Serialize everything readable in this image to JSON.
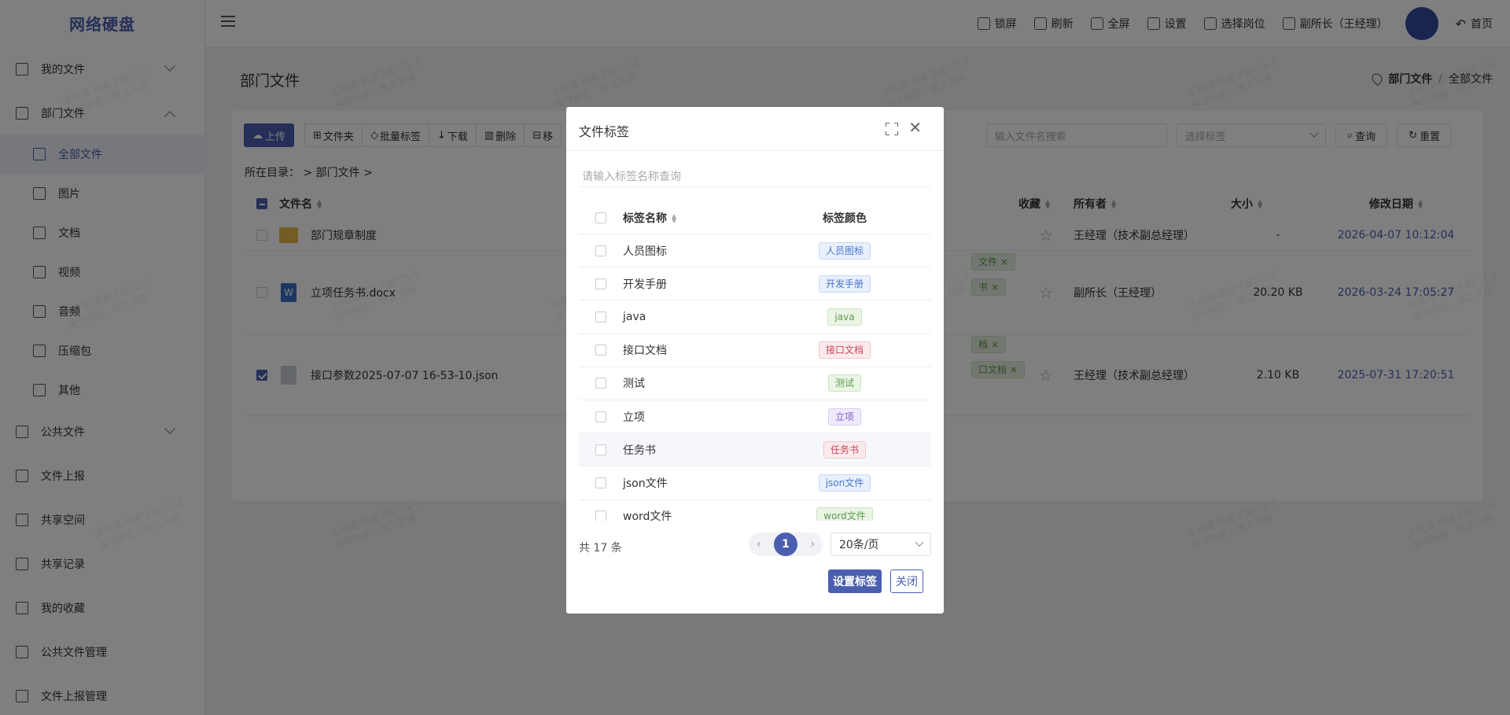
{
  "app": {
    "title": "网络硬盘"
  },
  "sidebar": {
    "items": [
      {
        "label": "我的文件",
        "icon": "document-icon",
        "caret": "down"
      },
      {
        "label": "部门文件",
        "icon": "copy-icon",
        "caret": "up"
      },
      {
        "label": "公共文件",
        "icon": "folder-icon",
        "caret": "down"
      },
      {
        "label": "文件上报",
        "icon": "upload-icon"
      },
      {
        "label": "共享空间",
        "icon": "cube-icon"
      },
      {
        "label": "共享记录",
        "icon": "share-icon"
      },
      {
        "label": "我的收藏",
        "icon": "star-icon"
      },
      {
        "label": "公共文件管理",
        "icon": "folder-settings-icon"
      },
      {
        "label": "文件上报管理",
        "icon": "folder-settings-icon"
      }
    ],
    "sub_items": [
      {
        "label": "全部文件",
        "icon": "copy-icon",
        "active": true
      },
      {
        "label": "图片",
        "icon": "image-icon"
      },
      {
        "label": "文档",
        "icon": "word-icon"
      },
      {
        "label": "视频",
        "icon": "video-icon"
      },
      {
        "label": "音频",
        "icon": "headphone-icon"
      },
      {
        "label": "压缩包",
        "icon": "zip-icon"
      },
      {
        "label": "其他",
        "icon": "more-icon"
      }
    ]
  },
  "topbar": {
    "actions": [
      {
        "label": "锁屏",
        "icon": "lock-icon"
      },
      {
        "label": "刷新",
        "icon": "refresh-icon"
      },
      {
        "label": "全屏",
        "icon": "fullscreen-icon"
      },
      {
        "label": "设置",
        "icon": "edit-icon"
      },
      {
        "label": "选择岗位",
        "icon": "switch-icon"
      },
      {
        "label": "副所长（王经理）",
        "icon": "user-icon"
      }
    ],
    "home_label": "首页"
  },
  "page": {
    "title": "部门文件",
    "breadcrumb": [
      "部门文件",
      "全部文件"
    ]
  },
  "toolbar": {
    "upload": "上传",
    "buttons": [
      "文件夹",
      "批量标签",
      "下载",
      "删除",
      "移"
    ],
    "search_placeholder": "输入文件名搜索",
    "tag_select_placeholder": "选择标签",
    "query": "查询",
    "reset": "重置"
  },
  "current_dir": {
    "label": "所在目录：",
    "path": "> 部门文件 >"
  },
  "table": {
    "columns": [
      "文件名",
      "收藏",
      "所有者",
      "大小",
      "修改日期"
    ],
    "rows": [
      {
        "name": "部门规章制度",
        "type": "folder",
        "owner": "王经理（技术副总经理）",
        "size": "-",
        "date": "2026-04-07 10:12:04",
        "checked": false
      },
      {
        "name": "立项任务书.docx",
        "type": "word",
        "owner": "副所长（王经理）",
        "size": "20.20 KB",
        "date": "2026-03-24 17:05:27",
        "checked": false,
        "tags": [
          "文件",
          "书"
        ]
      },
      {
        "name": "接口参数2025-07-07 16-53-10.json",
        "type": "json",
        "owner": "王经理（技术副总经理）",
        "size": "2.10 KB",
        "date": "2025-07-31 17:20:51",
        "checked": true,
        "tags": [
          "档",
          "口文档"
        ]
      }
    ]
  },
  "watermark": {
    "line1": "王经理-研发子部门1-1",
    "line2": "保守秘密，慎之又慎"
  },
  "dialog": {
    "title": "文件标签",
    "search_placeholder": "请输入标签名称查询",
    "col_name": "标签名称",
    "col_color": "标签颜色",
    "tags": [
      {
        "name": "人员图标",
        "bg": "#e8f0fc",
        "fg": "#4a74c9",
        "border": "#c7d8f5"
      },
      {
        "name": "开发手册",
        "bg": "#e8f0fc",
        "fg": "#4a74c9",
        "border": "#c7d8f5"
      },
      {
        "name": "java",
        "bg": "#eaf5e6",
        "fg": "#5c9b4a",
        "border": "#cbe6c1"
      },
      {
        "name": "接口文档",
        "bg": "#fbeaec",
        "fg": "#c64a5a",
        "border": "#f1c6cc"
      },
      {
        "name": "测试",
        "bg": "#eaf5e6",
        "fg": "#5c9b4a",
        "border": "#cbe6c1"
      },
      {
        "name": "立项",
        "bg": "#efeafb",
        "fg": "#7a5cc6",
        "border": "#d8cdf3"
      },
      {
        "name": "任务书",
        "bg": "#fbeaec",
        "fg": "#c64a5a",
        "border": "#f1c6cc",
        "highlight": true
      },
      {
        "name": "json文件",
        "bg": "#e8f0fc",
        "fg": "#4a74c9",
        "border": "#c7d8f5"
      },
      {
        "name": "word文件",
        "bg": "#eaf5e6",
        "fg": "#5c9b4a",
        "border": "#cbe6c1"
      }
    ],
    "total": "共 17 条",
    "current_page": "1",
    "page_size": "20条/页",
    "set_button": "设置标签",
    "close_button": "关闭"
  },
  "colors": {
    "accent": "#4a5fb0",
    "overlay": "rgba(0,0,0,0.5)"
  }
}
